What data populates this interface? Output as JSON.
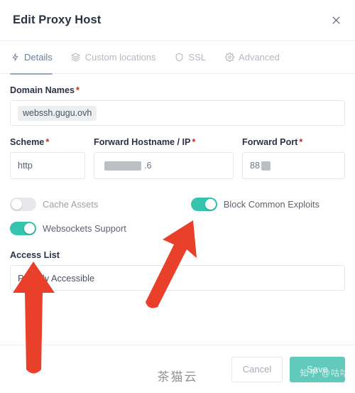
{
  "header": {
    "title": "Edit Proxy Host",
    "close_icon": "close-icon"
  },
  "tabs": [
    {
      "label": "Details",
      "icon": "zap-icon",
      "active": true
    },
    {
      "label": "Custom locations",
      "icon": "layers-icon",
      "active": false
    },
    {
      "label": "SSL",
      "icon": "shield-icon",
      "active": false
    },
    {
      "label": "Advanced",
      "icon": "gear-icon",
      "active": false
    }
  ],
  "form": {
    "domain_names": {
      "label": "Domain Names",
      "required_marker": "*",
      "chips": [
        "webssh.gugu.ovh"
      ]
    },
    "scheme": {
      "label": "Scheme",
      "required_marker": "*",
      "value": "http"
    },
    "forward_hostname": {
      "label": "Forward Hostname / IP",
      "required_marker": "*",
      "value_prefix": "",
      "value_suffix": ".6",
      "redacted": true
    },
    "forward_port": {
      "label": "Forward Port",
      "required_marker": "*",
      "value_prefix": "88",
      "redacted": true
    },
    "toggles": [
      {
        "label": "Cache Assets",
        "on": false,
        "muted": true
      },
      {
        "label": "Block Common Exploits",
        "on": true,
        "muted": false
      },
      {
        "label": "Websockets Support",
        "on": true,
        "muted": false
      }
    ],
    "access_list": {
      "label": "Access List",
      "value": "Publicly Accessible"
    }
  },
  "footer": {
    "cancel_label": "Cancel",
    "save_label": "Save"
  },
  "watermarks": {
    "center": "茶猫云",
    "corner": "知乎 @咕咕"
  },
  "colors": {
    "toggle_on": "#35c4ae",
    "save_button": "#62c9bd",
    "arrow": "#e8402a",
    "title_text": "#2a3243"
  },
  "annotations": [
    {
      "name": "arrow-up-access-list",
      "direction": "up"
    },
    {
      "name": "arrow-diagonal-block-common-exploits",
      "direction": "up-right"
    }
  ]
}
